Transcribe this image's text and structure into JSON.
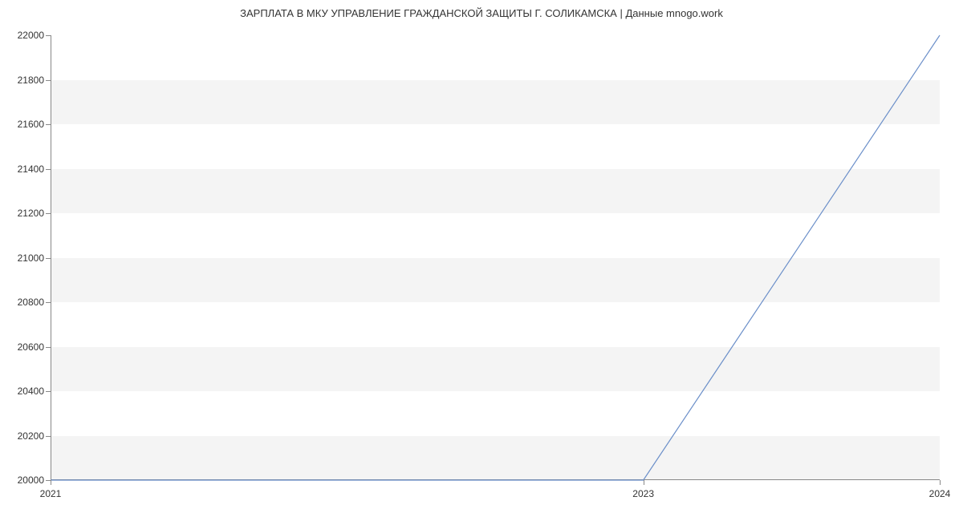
{
  "chart_data": {
    "type": "line",
    "title": "ЗАРПЛАТА В МКУ УПРАВЛЕНИЕ ГРАЖДАНСКОЙ ЗАЩИТЫ Г. СОЛИКАМСКА | Данные mnogo.work",
    "x": [
      2021,
      2023,
      2024
    ],
    "values": [
      20000,
      20000,
      22000
    ],
    "xlabel": "",
    "ylabel": "",
    "x_ticks": [
      2021,
      2023,
      2024
    ],
    "y_ticks": [
      20000,
      20200,
      20400,
      20600,
      20800,
      21000,
      21200,
      21400,
      21600,
      21800,
      22000
    ],
    "x_range": [
      2021,
      2024
    ],
    "ylim": [
      20000,
      22000
    ],
    "line_color": "#6b8fc9"
  }
}
